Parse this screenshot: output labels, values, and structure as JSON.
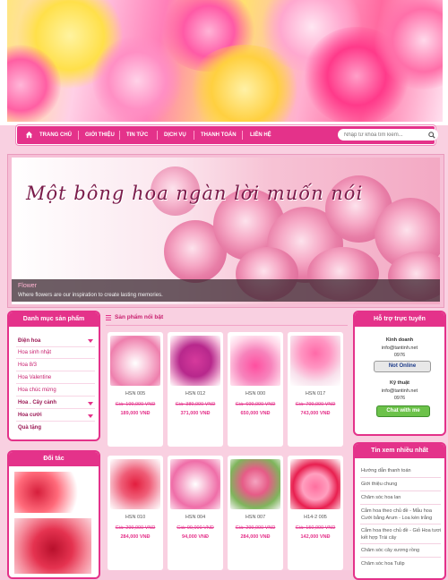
{
  "nav": {
    "items": [
      "TRANG CHỦ",
      "GIỚI THIỆU",
      "TIN TỨC",
      "DỊCH VỤ",
      "THANH TOÁN",
      "LIÊN HỆ"
    ],
    "search_placeholder": "Nhập từ khóa tìm kiếm..."
  },
  "slideshow": {
    "title": "Một bông hoa ngàn lời muốn nói",
    "caption_title": "Flower",
    "caption_text": "Where flowers are our inspiration to create lasting memories."
  },
  "categories": {
    "title": "Danh mục sản phẩm",
    "items": [
      "Điện hoa",
      "Hoa sinh nhật",
      "Hoa 8/3",
      "Hoa Valentine",
      "Hoa chúc mừng",
      "Hoa . Cây cảnh",
      "Hoa cưới",
      "Quà tặng"
    ]
  },
  "partners": {
    "title": "Đối tác"
  },
  "products": {
    "title": "Sản phẩm nổi bật",
    "items": [
      {
        "code": "HSN 005",
        "old": "Giá: 199,000 VNĐ",
        "new": "189,000 VNĐ"
      },
      {
        "code": "HSN 012",
        "old": "Giá: 389,000 VNĐ",
        "new": "371,000 VNĐ"
      },
      {
        "code": "HSN 000",
        "old": "Giá: 699,000 VNĐ",
        "new": "650,000 VNĐ"
      },
      {
        "code": "HSN 017",
        "old": "Giá: 799,000 VNĐ",
        "new": "743,000 VNĐ"
      },
      {
        "code": "HSN 010",
        "old": "Giá: 299,000 VNĐ",
        "new": "284,000 VNĐ"
      },
      {
        "code": "HSN 004",
        "old": "Giá: 99,000 VNĐ",
        "new": "94,000 VNĐ"
      },
      {
        "code": "HSN 007",
        "old": "Giá: 299,000 VNĐ",
        "new": "284,000 VNĐ"
      },
      {
        "code": "H14-2 005",
        "old": "Giá: 150,000 VNĐ",
        "new": "142,000 VNĐ"
      }
    ]
  },
  "support": {
    "title": "Hỗ trợ trực tuyến",
    "sales_label": "Kinh doanh",
    "sales_email": "info@tantinh.net",
    "sales_phone": "0976",
    "status": "Not Online",
    "tech_label": "Kỹ thuật",
    "tech_email": "info@tantinh.net",
    "tech_phone": "0976",
    "chat": "Chat with me"
  },
  "news": {
    "title": "Tin xem nhiều nhất",
    "items": [
      "Hướng dẫn thanh toán",
      "Giới thiệu chung",
      "Chăm sóc hoa lan",
      "Cắm hoa theo chủ đề - Mẫu hoa Cưới bằng Arum - Loa kèn trắng",
      "Cắm hoa theo chủ đề - Giỏ Hoa tươi kết hợp Trái cây",
      "Chăm sóc cây xương rồng",
      "Chăm sóc hoa Tulip"
    ]
  },
  "colors": {
    "accent": "#e4328a",
    "background": "#f9d0e1",
    "price": "#e4328a"
  }
}
